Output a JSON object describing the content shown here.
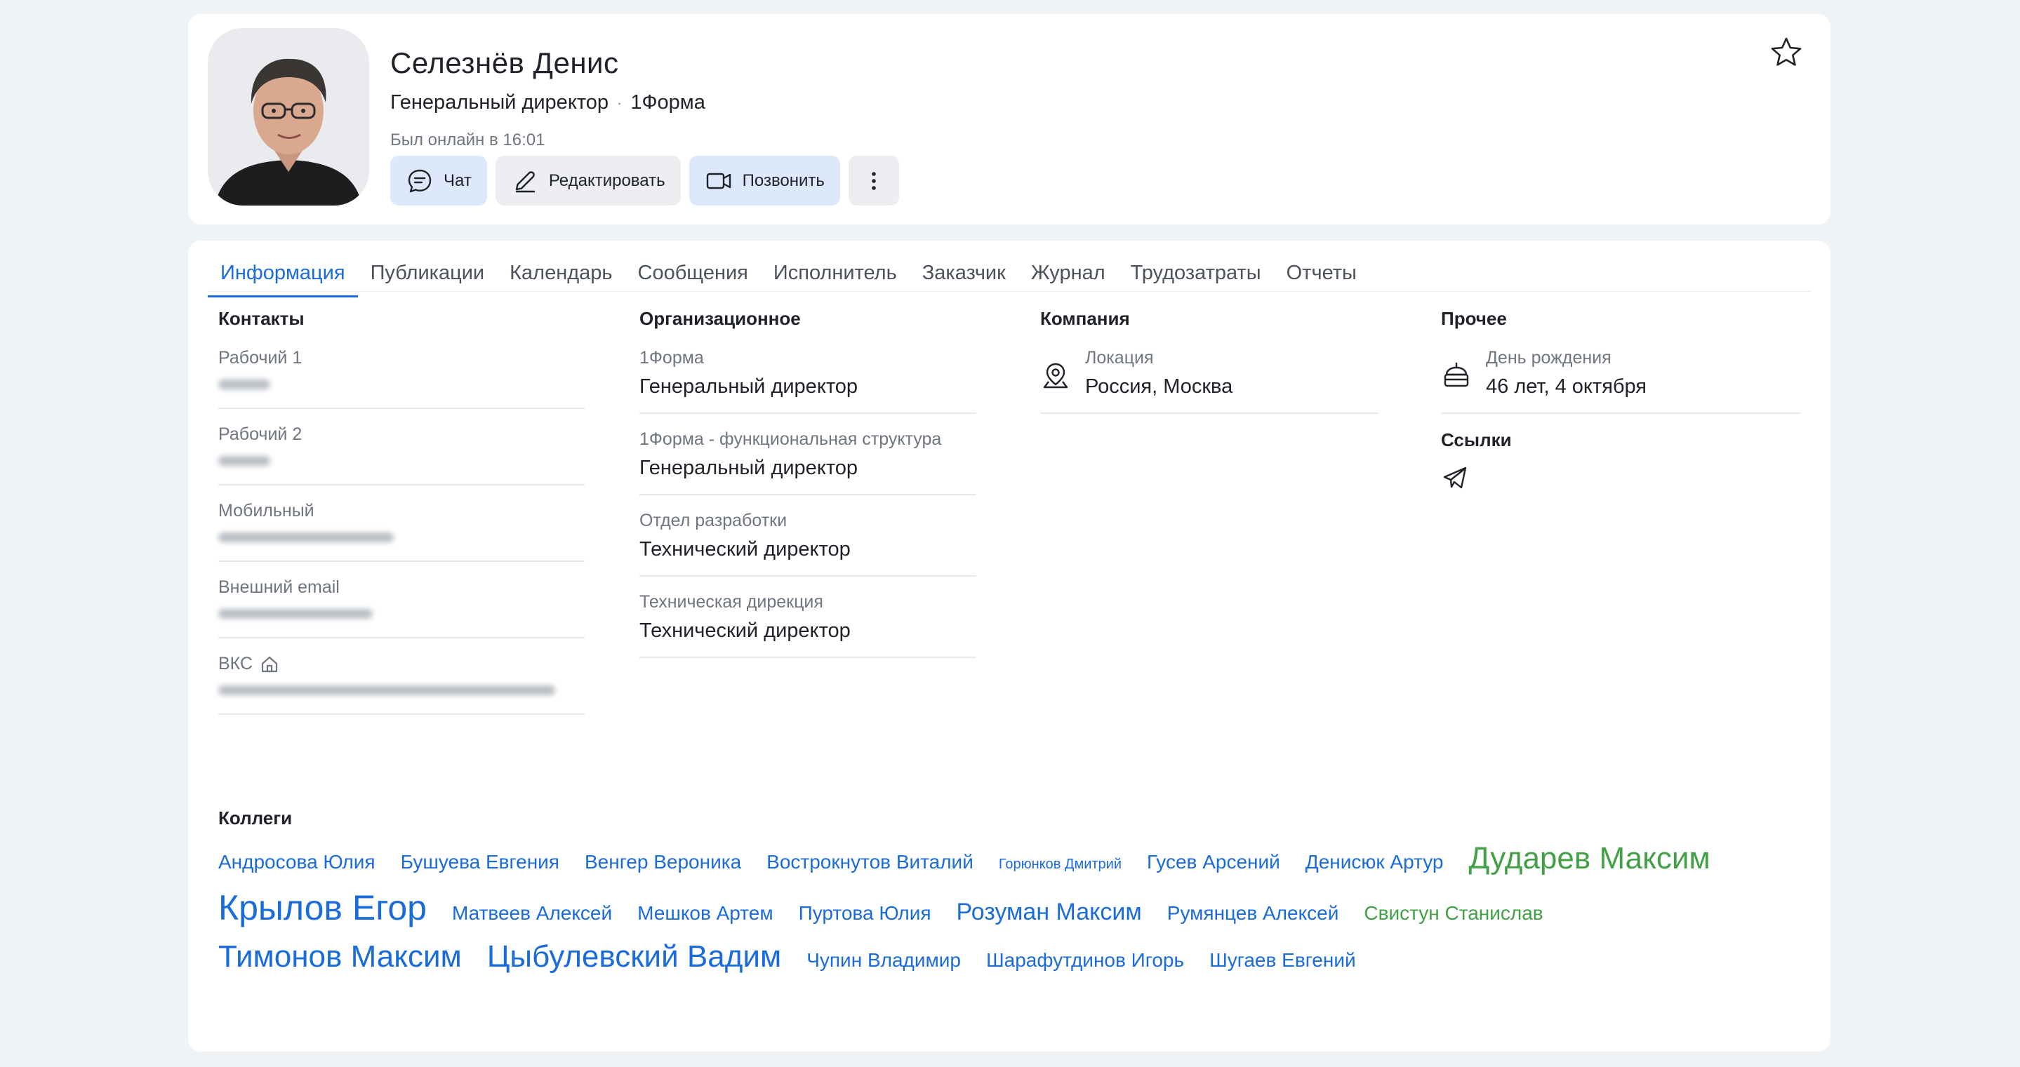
{
  "profile": {
    "name": "Селезнёв Денис",
    "position": "Генеральный директор",
    "company": "1Форма",
    "online_status": "Был онлайн в 16:01",
    "actions": {
      "chat": "Чат",
      "edit": "Редактировать",
      "call": "Позвонить"
    }
  },
  "tabs": [
    "Информация",
    "Публикации",
    "Календарь",
    "Сообщения",
    "Исполнитель",
    "Заказчик",
    "Журнал",
    "Трудозатраты",
    "Отчеты"
  ],
  "contacts": {
    "title": "Контакты",
    "fields": [
      {
        "label": "Рабочий 1"
      },
      {
        "label": "Рабочий 2"
      },
      {
        "label": "Мобильный"
      },
      {
        "label": "Внешний email"
      },
      {
        "label": "ВКС"
      }
    ]
  },
  "org": {
    "title": "Организационное",
    "fields": [
      {
        "label": "1Форма",
        "value": "Генеральный директор"
      },
      {
        "label": "1Форма - функциональная структура",
        "value": "Генеральный директор"
      },
      {
        "label": "Отдел разработки",
        "value": "Технический директор"
      },
      {
        "label": "Техническая дирекция",
        "value": "Технический директор"
      }
    ]
  },
  "company": {
    "title": "Компания",
    "location_label": "Локация",
    "location_value": "Россия, Москва"
  },
  "other": {
    "title": "Прочее",
    "birthday_label": "День рождения",
    "birthday_value": "46 лет, 4 октября",
    "links_title": "Ссылки"
  },
  "colleagues": {
    "title": "Коллеги",
    "items": [
      {
        "name": "Андросова Юлия",
        "size": 2,
        "color": "blue"
      },
      {
        "name": "Бушуева Евгения",
        "size": 2,
        "color": "blue"
      },
      {
        "name": "Венгер Вероника",
        "size": 2,
        "color": "blue"
      },
      {
        "name": "Вострокнутов Виталий",
        "size": 2,
        "color": "blue"
      },
      {
        "name": "Горюнков Дмитрий",
        "size": 1,
        "color": "blue"
      },
      {
        "name": "Гусев Арсений",
        "size": 2,
        "color": "blue"
      },
      {
        "name": "Денисюк Артур",
        "size": 2,
        "color": "blue"
      },
      {
        "name": "Дударев Максим",
        "size": 4,
        "color": "green"
      },
      {
        "name": "Крылов Егор",
        "size": 5,
        "color": "blue"
      },
      {
        "name": "Матвеев Алексей",
        "size": 2,
        "color": "blue"
      },
      {
        "name": "Мешков Артем",
        "size": 2,
        "color": "blue"
      },
      {
        "name": "Пуртова Юлия",
        "size": 2,
        "color": "blue"
      },
      {
        "name": "Розуман Максим",
        "size": 3,
        "color": "blue"
      },
      {
        "name": "Румянцев Алексей",
        "size": 2,
        "color": "blue"
      },
      {
        "name": "Свистун Станислав",
        "size": 2,
        "color": "green"
      },
      {
        "name": "Тимонов Максим",
        "size": 4,
        "color": "blue"
      },
      {
        "name": "Цыбулевский Вадим",
        "size": 4,
        "color": "blue"
      },
      {
        "name": "Чупин Владимир",
        "size": 2,
        "color": "blue"
      },
      {
        "name": "Шарафутдинов Игорь",
        "size": 2,
        "color": "blue"
      },
      {
        "name": "Шугаев Евгений",
        "size": 2,
        "color": "blue"
      }
    ]
  },
  "colors": {
    "accent": "#1a6bdc",
    "green": "#43a047",
    "button_blue": "#dde9fb",
    "button_gray": "#eceef1"
  }
}
